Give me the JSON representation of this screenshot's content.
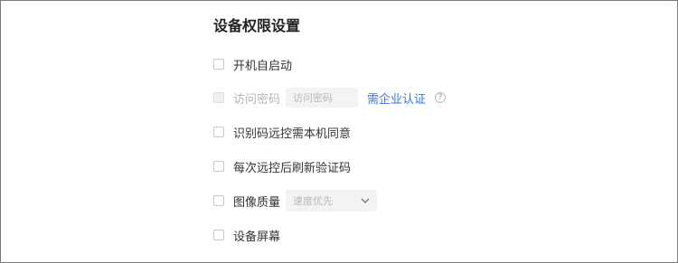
{
  "section": {
    "title": "设备权限设置"
  },
  "options": {
    "autostart": {
      "label": "开机自启动"
    },
    "access_password": {
      "label": "访问密码",
      "placeholder": "访问密码",
      "link": "需企业认证",
      "help_icon": "question-circle-icon"
    },
    "require_consent": {
      "label": "识别码远控需本机同意"
    },
    "refresh_code": {
      "label": "每次远控后刷新验证码"
    },
    "image_quality": {
      "label": "图像质量",
      "selected": "速度优先",
      "dropdown_icon": "chevron-down-icon"
    },
    "device_screen": {
      "label": "设备屏幕"
    }
  },
  "colors": {
    "link": "#3d73d8",
    "disabled_text": "#b5b5b5",
    "field_bg": "#f3f3f3"
  }
}
